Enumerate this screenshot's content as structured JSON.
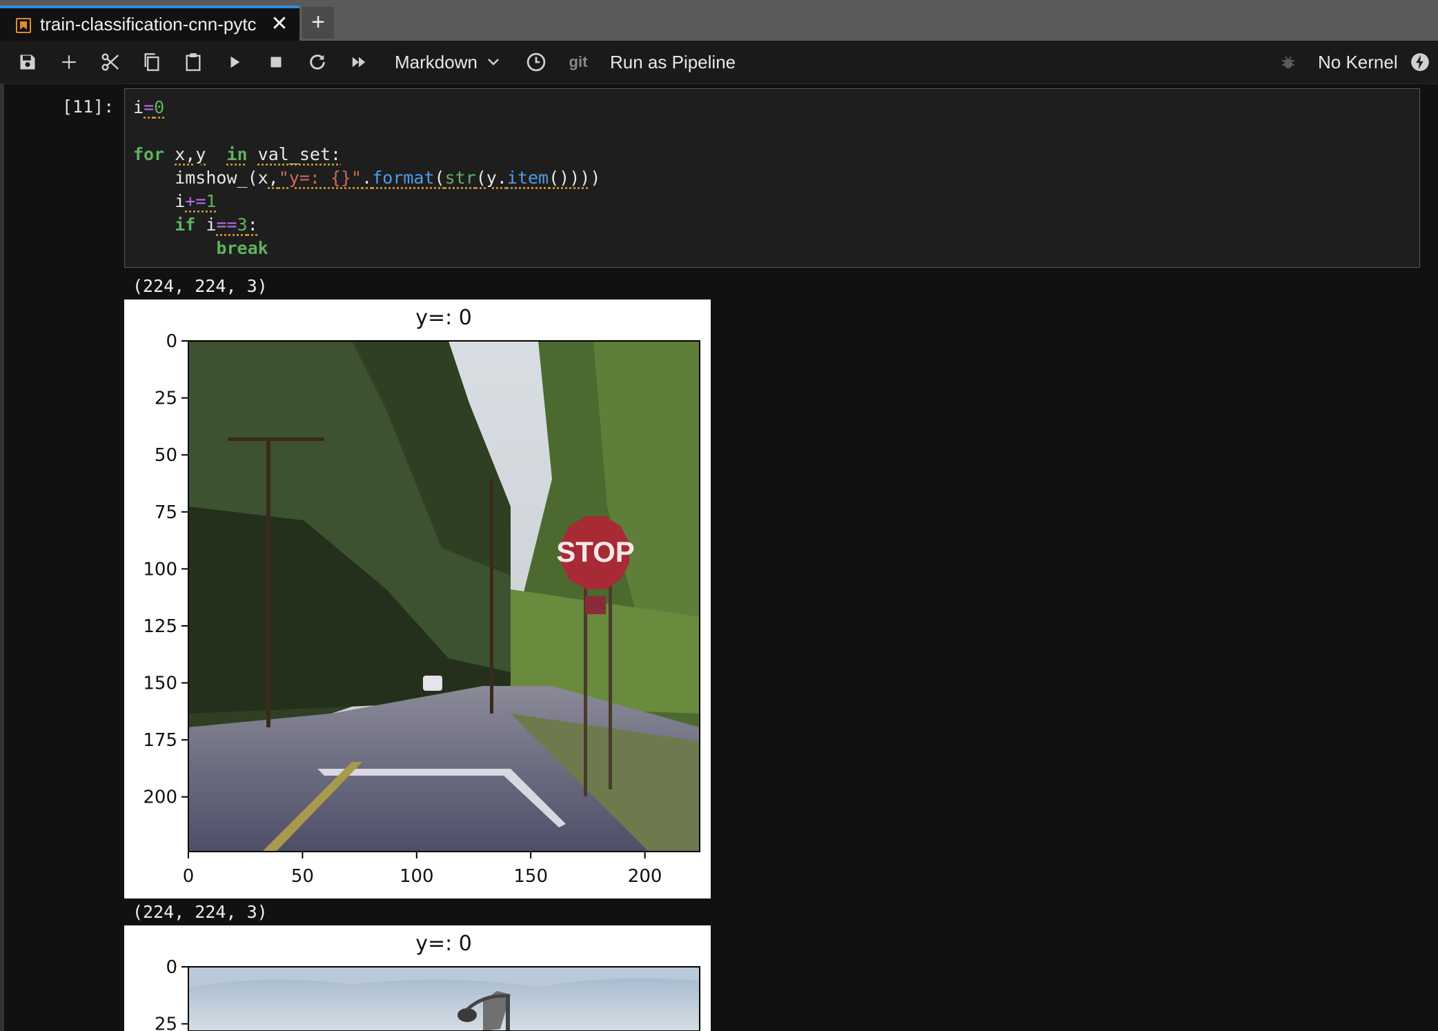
{
  "tab": {
    "title": "train-classification-cnn-pytc",
    "close": "✕",
    "add": "+"
  },
  "toolbar": {
    "cell_type": "Markdown",
    "git": "git",
    "run_pipeline": "Run as Pipeline",
    "kernel": "No Kernel",
    "icons": [
      "save-icon",
      "add-cell-icon",
      "cut-icon",
      "copy-icon",
      "paste-icon",
      "run-icon",
      "stop-icon",
      "restart-icon",
      "run-all-icon",
      "chevron-down-icon",
      "clock-icon",
      "debug-icon",
      "kernel-status-icon"
    ]
  },
  "cell": {
    "prompt": "[11]:",
    "code_lines": [
      "i=0",
      "",
      "for x,y  in val_set:",
      "    imshow_(x,\"y=: {}\".format(str(y.item())))",
      "    i+=1",
      "    if i==3:",
      "        break"
    ]
  },
  "outputs": [
    {
      "shape_text": "(224, 224, 3)",
      "chart_data": {
        "type": "image",
        "title": "y=: 0",
        "xlabel": "",
        "ylabel": "",
        "xlim": [
          0,
          224
        ],
        "ylim": [
          224,
          0
        ],
        "x_ticks": [
          0,
          50,
          100,
          150,
          200
        ],
        "y_ticks": [
          0,
          25,
          50,
          75,
          100,
          125,
          150,
          175,
          200
        ],
        "sign_text": "STOP"
      }
    },
    {
      "shape_text": "(224, 224, 3)",
      "chart_data": {
        "type": "image",
        "title": "y=: 0",
        "xlabel": "",
        "ylabel": "",
        "xlim": [
          0,
          224
        ],
        "ylim": [
          224,
          0
        ],
        "x_ticks": [],
        "y_ticks": [
          0,
          25
        ]
      }
    }
  ]
}
